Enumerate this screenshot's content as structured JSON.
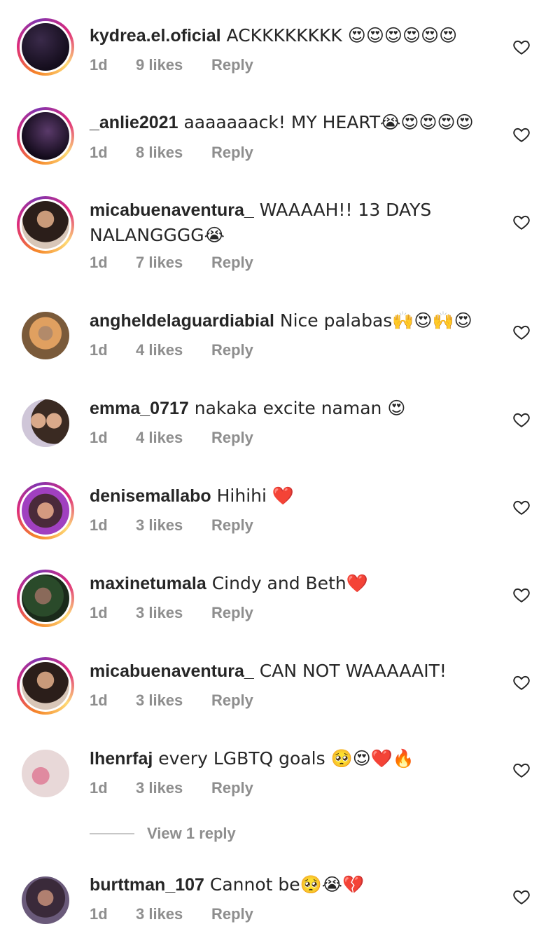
{
  "comments": [
    {
      "username": "kydrea.el.oficial",
      "text": " ACKKKKKKKK 😍😍😍😍😍😍",
      "time": "1d",
      "likes": "9 likes",
      "reply": "Reply"
    },
    {
      "username": "_anlie2021",
      "text": " aaaaaaack! MY HEART😭😍😍😍😍",
      "time": "1d",
      "likes": "8 likes",
      "reply": "Reply"
    },
    {
      "username": "micabuenaventura_",
      "text": " WAAAAH!! 13 DAYS NALANGGGG😭",
      "time": "1d",
      "likes": "7 likes",
      "reply": "Reply"
    },
    {
      "username": "angheldelaguardiabial",
      "text": " Nice palabas🙌😍🙌😍",
      "time": "1d",
      "likes": "4 likes",
      "reply": "Reply"
    },
    {
      "username": "emma_0717",
      "text": " nakaka excite naman 😍",
      "time": "1d",
      "likes": "4 likes",
      "reply": "Reply"
    },
    {
      "username": "denisemallabo",
      "text": " Hihihi ❤️",
      "time": "1d",
      "likes": "3 likes",
      "reply": "Reply"
    },
    {
      "username": "maxinetumala",
      "text": " Cindy and Beth❤️",
      "time": "1d",
      "likes": "3 likes",
      "reply": "Reply"
    },
    {
      "username": "micabuenaventura_",
      "text": " CAN NOT WAAAAAIT!",
      "time": "1d",
      "likes": "3 likes",
      "reply": "Reply"
    },
    {
      "username": "lhenrfaj",
      "text": " every LGBTQ goals 🥺😍❤️🔥",
      "time": "1d",
      "likes": "3 likes",
      "reply": "Reply"
    },
    {
      "username": "burttman_107",
      "text": " Cannot be🥺😭💔",
      "time": "1d",
      "likes": "3 likes",
      "reply": "Reply"
    }
  ],
  "view_replies_label": "View 1 reply",
  "icons": {
    "like": "heart-outline-icon"
  },
  "colors": {
    "story_ring": "#dd2a7b",
    "meta": "#8e8e8e",
    "text": "#262626"
  }
}
